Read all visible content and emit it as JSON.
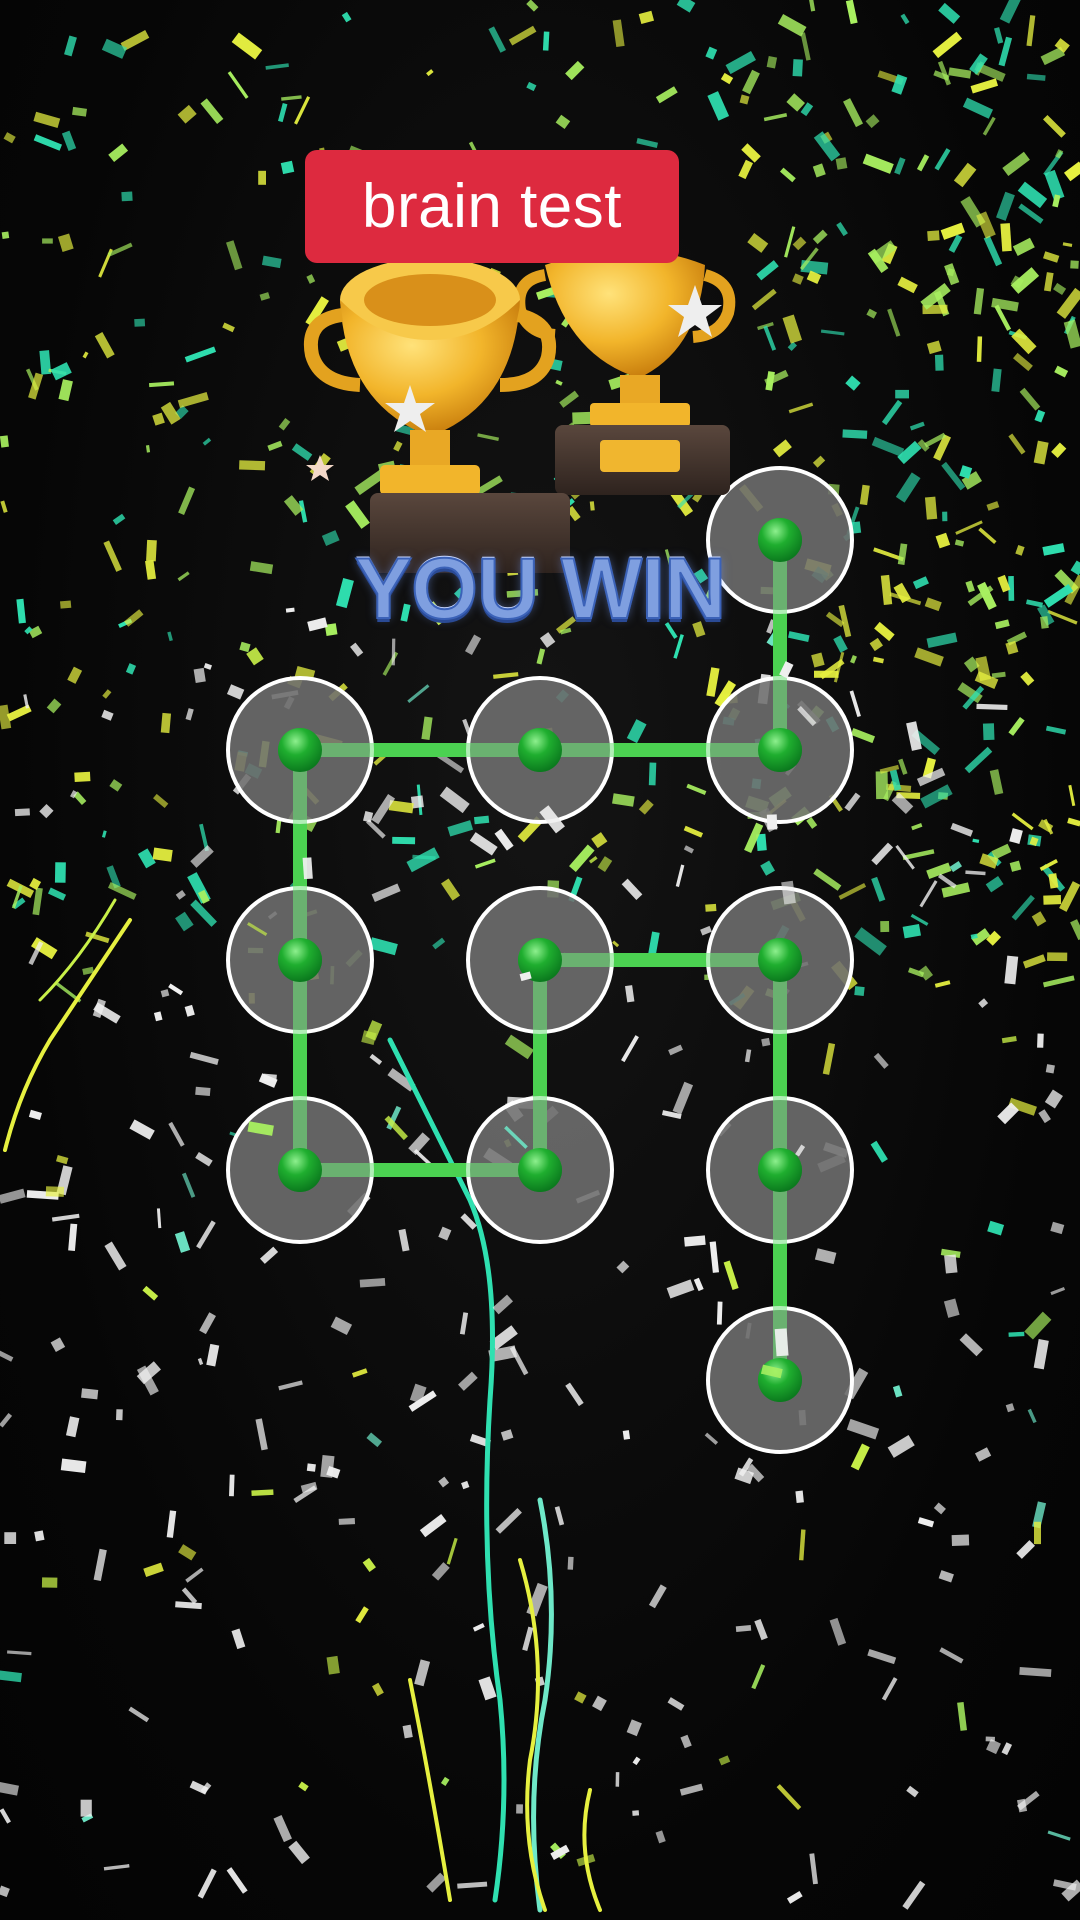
{
  "title": {
    "label": "brain test",
    "background": "#dd2a3f"
  },
  "result": {
    "label": "YOU WIN",
    "color": "#7f9fe0"
  },
  "trophies": {
    "icon": "two-gold-trophies-icon",
    "cup_color": "#f2b52b",
    "base_color": "#4a3a32",
    "star_color": "#eeeeee"
  },
  "pattern": {
    "line_color": "#1fbf1f",
    "node_color": "#1fae2f",
    "ring_color": "#ffffff",
    "disc_color": "#6f6f6f",
    "nodes": [
      {
        "id": "n1",
        "row": 0,
        "col": 2
      },
      {
        "id": "n2",
        "row": 1,
        "col": 0
      },
      {
        "id": "n3",
        "row": 1,
        "col": 1
      },
      {
        "id": "n4",
        "row": 1,
        "col": 2
      },
      {
        "id": "n5",
        "row": 2,
        "col": 0
      },
      {
        "id": "n6",
        "row": 2,
        "col": 1
      },
      {
        "id": "n7",
        "row": 2,
        "col": 2
      },
      {
        "id": "n8",
        "row": 3,
        "col": 0
      },
      {
        "id": "n9",
        "row": 3,
        "col": 1
      },
      {
        "id": "n10",
        "row": 3,
        "col": 2
      },
      {
        "id": "n11",
        "row": 4,
        "col": 2
      }
    ],
    "path": [
      "n1",
      "n4",
      "n3",
      "n2",
      "n5",
      "n8",
      "n9",
      "n6",
      "n7",
      "n10",
      "n11"
    ]
  },
  "confetti_colors": [
    "#2fe0b0",
    "#a8f060",
    "#e6f040",
    "#f0f0f0",
    "#6ee8c8",
    "#c8f048"
  ]
}
